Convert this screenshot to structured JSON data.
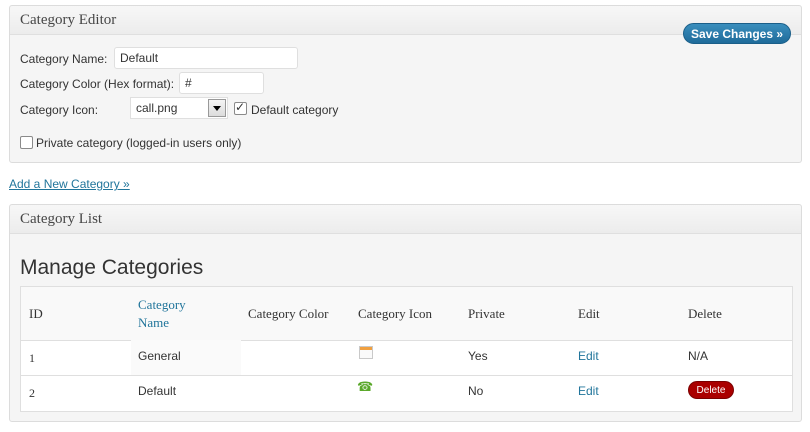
{
  "editor": {
    "title": "Category Editor",
    "save_label": "Save Changes »",
    "name_label": "Category Name:",
    "name_value": "Default",
    "color_label": "Category Color (Hex format):",
    "color_value": "#",
    "icon_label": "Category Icon:",
    "icon_value": "call.png",
    "default_label": "Default category",
    "default_checked": true,
    "private_label": "Private category (logged-in users only)",
    "private_checked": false
  },
  "add_link": "Add a New Category »",
  "list": {
    "title": "Category List",
    "heading": "Manage Categories",
    "columns": {
      "id": "ID",
      "name_line1": "Category",
      "name_line2": "Name",
      "color": "Category Color",
      "icon": "Category Icon",
      "private": "Private",
      "edit": "Edit",
      "delete": "Delete"
    },
    "rows": [
      {
        "id": "1",
        "name": "General",
        "icon": "calendar-icon",
        "private": "Yes",
        "edit": "Edit",
        "delete": "N/A"
      },
      {
        "id": "2",
        "name": "Default",
        "icon": "phone-icon",
        "private": "No",
        "edit": "Edit",
        "delete": "Delete"
      }
    ]
  },
  "colors": {
    "link": "#21759b",
    "save_button": "#2a7bab",
    "delete_button": "#aa0000",
    "phone_icon": "#5aa82a"
  }
}
